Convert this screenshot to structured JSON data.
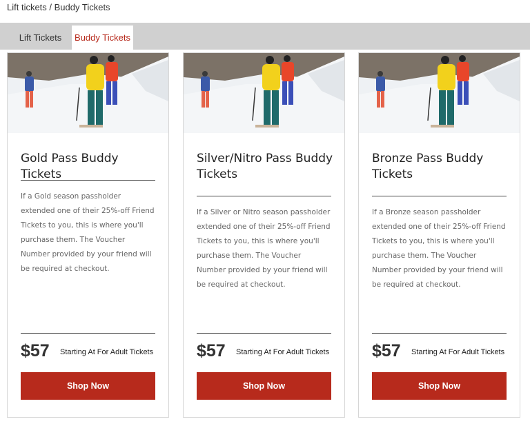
{
  "breadcrumb": "Lift tickets / Buddy Tickets",
  "tabs": [
    {
      "label": "Lift Tickets",
      "active": false
    },
    {
      "label": "Buddy Tickets",
      "active": true
    }
  ],
  "colors": {
    "accent": "#b72a1c",
    "tabbar": "#d0d0d0",
    "price_text": "#333333"
  },
  "cards": [
    {
      "title": "Gold Pass Buddy Tickets",
      "description": "If a Gold season passholder extended one of their 25%-off Friend Tickets to you, this is where you'll purchase them. The Voucher Number provided by your friend will be required at checkout.",
      "price": "$57",
      "price_label": "Starting At For Adult Tickets",
      "button_label": "Shop Now"
    },
    {
      "title": "Silver/Nitro Pass Buddy Tickets",
      "description": "If a Silver or Nitro season passholder extended one of their 25%-off Friend Tickets to you, this is where you'll purchase them. The Voucher Number provided by your friend will be required at checkout.",
      "price": "$57",
      "price_label": "Starting At For Adult Tickets",
      "button_label": "Shop Now"
    },
    {
      "title": "Bronze Pass Buddy Tickets",
      "description": "If a Bronze season passholder extended one of their 25%-off Friend Tickets to you, this is where you'll purchase them. The Voucher Number provided by your friend will be required at checkout.",
      "price": "$57",
      "price_label": "Starting At For Adult Tickets",
      "button_label": "Shop Now"
    }
  ]
}
